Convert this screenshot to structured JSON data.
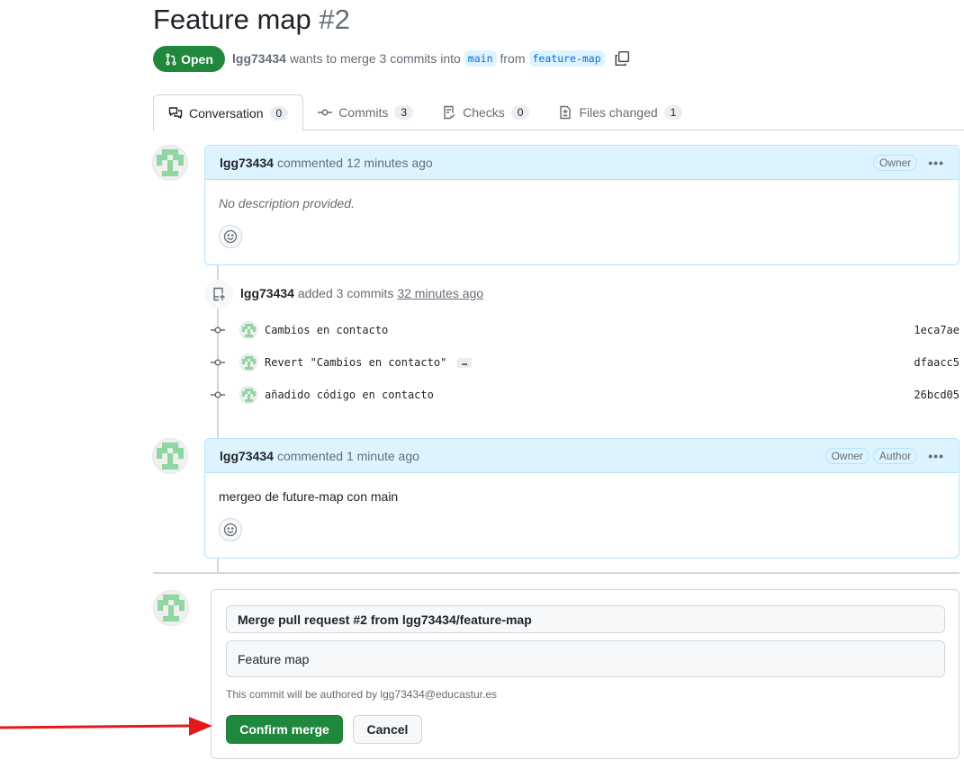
{
  "pr": {
    "title": "Feature map",
    "number": "#2",
    "state": "Open",
    "author": "lgg73434",
    "summary": "wants to merge 3 commits into",
    "base": "main",
    "from": "from",
    "head": "feature-map"
  },
  "tabs": [
    {
      "label": "Conversation",
      "count": "0",
      "icon": "comment-discussion-icon"
    },
    {
      "label": "Commits",
      "count": "3",
      "icon": "git-commit-icon"
    },
    {
      "label": "Checks",
      "count": "0",
      "icon": "checklist-icon"
    },
    {
      "label": "Files changed",
      "count": "1",
      "icon": "file-diff-icon"
    }
  ],
  "comments": [
    {
      "author": "lgg73434",
      "action": "commented 12 minutes ago",
      "labels": [
        "Owner"
      ],
      "body": "No description provided."
    },
    {
      "author": "lgg73434",
      "action": "commented 1 minute ago",
      "labels": [
        "Owner",
        "Author"
      ],
      "body": "mergeo de future-map con main"
    }
  ],
  "commits_event": {
    "author": "lgg73434",
    "text": "added 3 commits",
    "time": "32 minutes ago"
  },
  "commits": [
    {
      "message": "Cambios en contacto",
      "sha": "1eca7ae"
    },
    {
      "message": "Revert \"Cambios en contacto\"",
      "sha": "dfaacc5",
      "more": "…"
    },
    {
      "message": "añadido código en contacto",
      "sha": "26bcd05"
    }
  ],
  "merge": {
    "commit_title": "Merge pull request #2 from lgg73434/feature-map",
    "commit_body": "Feature map",
    "note": "This commit will be authored by lgg73434@educastur.es",
    "confirm": "Confirm merge",
    "cancel": "Cancel"
  },
  "colors": {
    "green": "#1f883d",
    "accent_blue": "#0969da",
    "annotation_arrow": "#e3191c"
  }
}
